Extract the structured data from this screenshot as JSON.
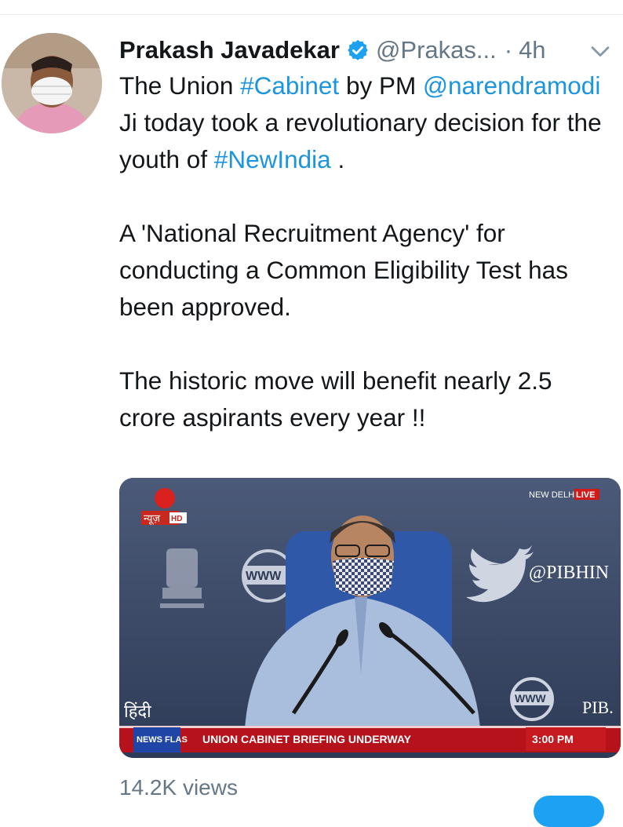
{
  "tweet": {
    "author_name": "Prakash Javadekar",
    "author_handle": "@Prakas...",
    "separator": "·",
    "time": "4h",
    "verified_icon": "verified-badge-icon",
    "more_icon": "chevron-down-icon",
    "text_parts": {
      "p1_a": "The Union ",
      "p1_tag1": "#Cabinet",
      "p1_b": " by PM ",
      "p1_mention": "@narendramodi",
      "p1_c": " Ji today took a revolutionary decision for the youth of ",
      "p1_tag2": "#NewIndia",
      "p1_d": " .",
      "p2": "A 'National Recruitment Agency' for conducting a Common Eligibility Test has been approved.",
      "p3": "The historic move will benefit nearly 2.5 crore aspirants every year !!"
    },
    "views": "14.2K views"
  },
  "video": {
    "channel_logo_text": "न्यूज़",
    "hd_badge": "HD",
    "location": "NEW DELHI",
    "live_badge": "LIVE",
    "pib_handle": "@PIBHIN",
    "hindi_label": "हिंदी",
    "www_text_left": "WWW",
    "www_text_right": "WWW",
    "pib_text": "PIB.",
    "ticker_badge": "NEWS FLAS",
    "ticker_text": "UNION CABINET BRIEFING UNDERWAY",
    "ticker_time": "3:00 PM"
  },
  "colors": {
    "link": "#1b95e0",
    "muted": "#657786",
    "verified": "#1da1f2",
    "ticker_red": "#b5121b"
  }
}
